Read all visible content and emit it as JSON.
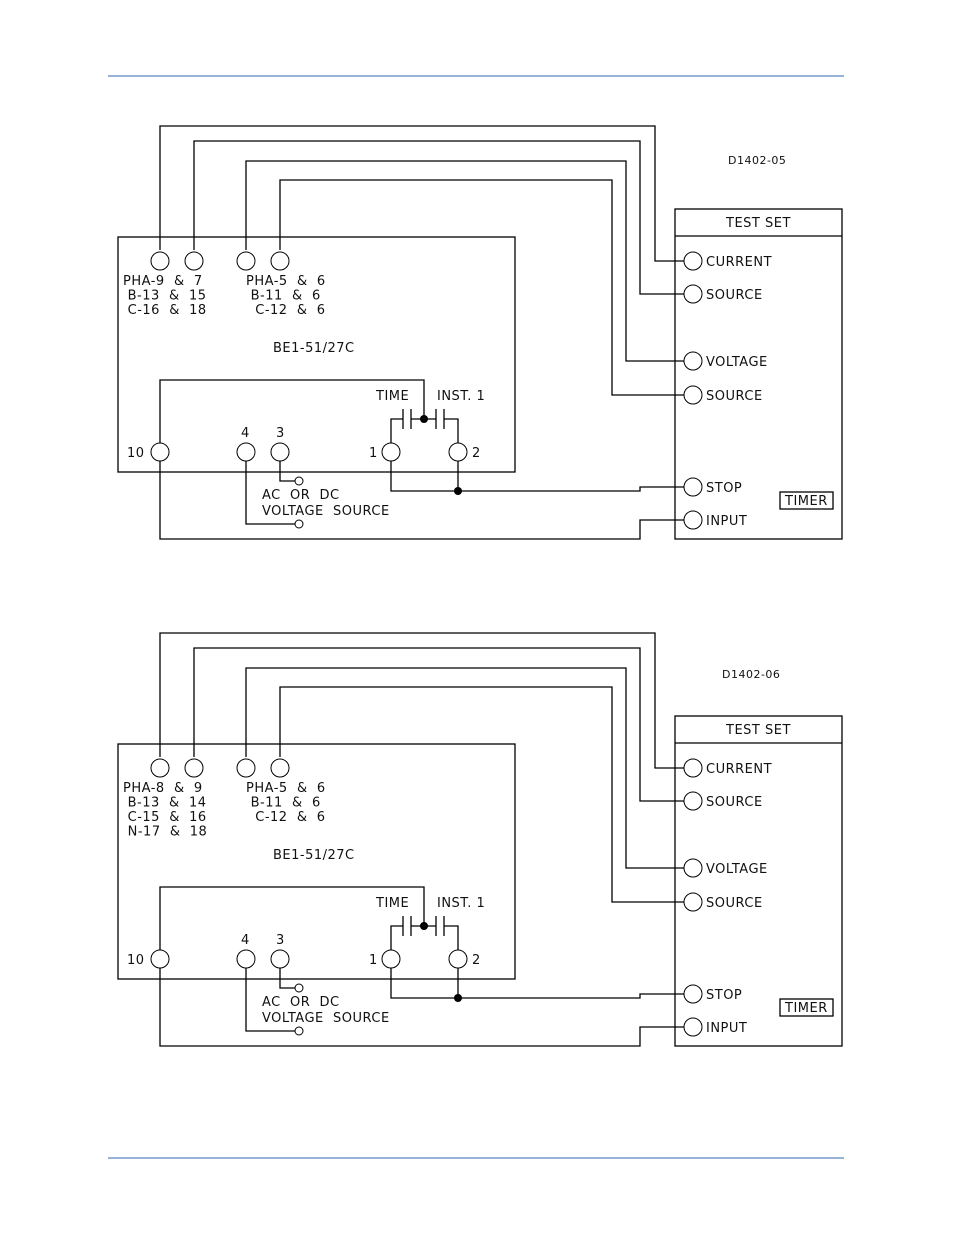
{
  "page": {
    "header_rule_color": "#95b3d7",
    "footer_rule_color": "#95b3d7"
  },
  "diagrams": [
    {
      "id_label": "D1402-05",
      "relay_label": "BE1-51/27C",
      "current_terminals_lines": [
        "PHA-9  &  7",
        " B-13  &  15",
        " C-16  &  18"
      ],
      "voltage_terminals_lines": [
        "PHA-5  &  6",
        " B-11  &  6",
        "  C-12  &  6"
      ],
      "terminal_labels": {
        "t10": "10",
        "t4": "4",
        "t3": "3",
        "t1": "1",
        "t2": "2"
      },
      "contact_labels": {
        "time": "TIME",
        "inst": "INST. 1"
      },
      "source_label_lines": [
        "AC  OR  DC",
        "VOLTAGE  SOURCE"
      ],
      "test_set": {
        "title": "TEST SET",
        "terminals": [
          "CURRENT",
          "SOURCE",
          "VOLTAGE",
          "SOURCE",
          "STOP",
          "INPUT"
        ],
        "timer_label": "TIMER"
      }
    },
    {
      "id_label": "D1402-06",
      "relay_label": "BE1-51/27C",
      "current_terminals_lines": [
        "PHA-8  &  9",
        " B-13  &  14",
        " C-15  &  16",
        " N-17  &  18"
      ],
      "voltage_terminals_lines": [
        "PHA-5  &  6",
        " B-11  &  6",
        "  C-12  &  6"
      ],
      "terminal_labels": {
        "t10": "10",
        "t4": "4",
        "t3": "3",
        "t1": "1",
        "t2": "2"
      },
      "contact_labels": {
        "time": "TIME",
        "inst": "INST. 1"
      },
      "source_label_lines": [
        "AC  OR  DC",
        "VOLTAGE  SOURCE"
      ],
      "test_set": {
        "title": "TEST SET",
        "terminals": [
          "CURRENT",
          "SOURCE",
          "VOLTAGE",
          "SOURCE",
          "STOP",
          "INPUT"
        ],
        "timer_label": "TIMER"
      }
    }
  ]
}
